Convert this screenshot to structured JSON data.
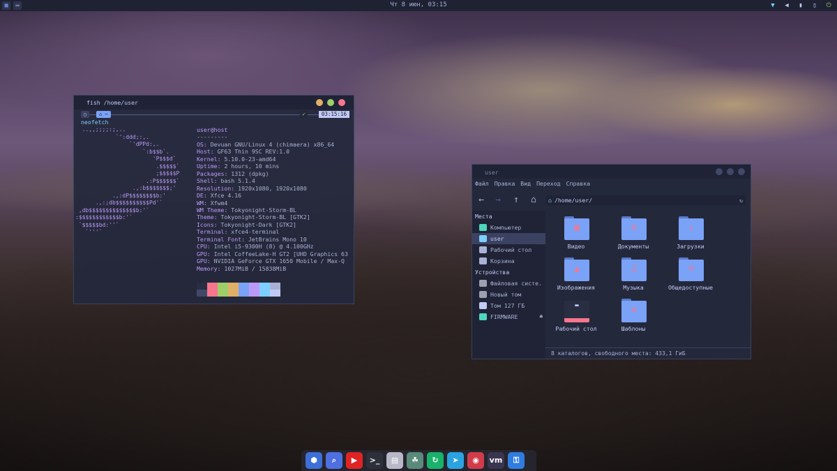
{
  "top_panel": {
    "clock": "Чт   8 июн, 03:15",
    "left_buttons": [
      "menu-icon",
      "terminal-icon"
    ],
    "right_icons": [
      "wifi-icon",
      "volume-icon",
      "battery-icon",
      "clipboard-icon",
      "power-icon"
    ]
  },
  "terminal": {
    "title": "fish /home/user",
    "prompt_time": "03:15:16",
    "prompt_chip_1": "○",
    "prompt_chip_2": "⌂ ~",
    "prompt_ok": "✓",
    "command": "neofetch",
    "ascii_art": "  ..,,;;;;:;,..\n            `':ddd;:,.\n                `'dPPd:,.\n                    `:b$$b`.\n                       'P$$$d`\n                        .$$$$$`\n                        ;$$$$$P\n                     .:P$$$$$$`\n                 .,:b$$$$$$$;'\n           .,:dP$$$$$$$$b:'\n      .,:;db$$$$$$$$$$Pd'`\n ,db$$$$$$$$$$$$$$b:'`\n:$$$$$$$$$$$$b:'`\n `$$$$$bd:''`\n   `'''`",
    "user_host": "user@host",
    "separator": "---------",
    "info": [
      {
        "k": "OS",
        "v": "Devuan GNU/Linux 4 (chimaera) x86_64"
      },
      {
        "k": "Host",
        "v": "GF63 Thin 9SC REV:1.0"
      },
      {
        "k": "Kernel",
        "v": "5.10.0-23-amd64"
      },
      {
        "k": "Uptime",
        "v": "2 hours, 10 mins"
      },
      {
        "k": "Packages",
        "v": "1312 (dpkg)"
      },
      {
        "k": "Shell",
        "v": "bash 5.1.4"
      },
      {
        "k": "Resolution",
        "v": "1920x1080, 1920x1080"
      },
      {
        "k": "DE",
        "v": "Xfce 4.16"
      },
      {
        "k": "WM",
        "v": "Xfwm4"
      },
      {
        "k": "WM Theme",
        "v": "Tokyonight-Storm-BL"
      },
      {
        "k": "Theme",
        "v": "Tokyonight-Storm-BL [GTK2]"
      },
      {
        "k": "Icons",
        "v": "Tokyonight-Dark [GTK2]"
      },
      {
        "k": "Terminal",
        "v": "xfce4-terminal"
      },
      {
        "k": "Terminal Font",
        "v": "JetBrains Mono 10"
      },
      {
        "k": "CPU",
        "v": "Intel i5-9300H (8) @ 4.100GHz"
      },
      {
        "k": "GPU",
        "v": "Intel CoffeeLake-H GT2 [UHD Graphics 63"
      },
      {
        "k": "GPU",
        "v": "NVIDIA GeForce GTX 1650 Mobile / Max-Q"
      },
      {
        "k": "Memory",
        "v": "1027MiB / 15838MiB"
      }
    ],
    "palette_top": [
      "#2a2e42",
      "#f7768e",
      "#9ece6a",
      "#e0af68",
      "#7aa2f7",
      "#bb9af7",
      "#7dcfff",
      "#a9b1d6"
    ],
    "palette_bottom": [
      "#414868",
      "#f7768e",
      "#9ece6a",
      "#e0af68",
      "#7aa2f7",
      "#bb9af7",
      "#7dcfff",
      "#c0caf5"
    ]
  },
  "file_manager": {
    "title": "user",
    "menu": [
      "Файл",
      "Правка",
      "Вид",
      "Переход",
      "Справка"
    ],
    "path": "/home/user/",
    "places_header": "Места",
    "places": [
      {
        "label": "Компьютер",
        "icon": "computer-icon",
        "color": "#4fd6be",
        "selected": false
      },
      {
        "label": "user",
        "icon": "home-icon",
        "color": "#7dcfff",
        "selected": true
      },
      {
        "label": "Рабочий стол",
        "icon": "desktop-icon",
        "color": "#a9b1d6",
        "selected": false
      },
      {
        "label": "Корзина",
        "icon": "trash-icon",
        "color": "#a9b1d6",
        "selected": false
      }
    ],
    "devices_header": "Устройства",
    "devices": [
      {
        "label": "Файловая систе...",
        "icon": "drive-icon",
        "color": "#9aa0b0",
        "eject": ""
      },
      {
        "label": "Новый том",
        "icon": "drive-icon",
        "color": "#9aa0b0",
        "eject": ""
      },
      {
        "label": "Том 127 ГБ",
        "icon": "drive-icon",
        "color": "#c0caf5",
        "eject": ""
      },
      {
        "label": "FIRMWARE",
        "icon": "usb-icon",
        "color": "#4fd6be",
        "eject": "⏏"
      }
    ],
    "items": [
      {
        "label": "Видео",
        "icon": "video-folder-icon",
        "glyph": "▦"
      },
      {
        "label": "Документы",
        "icon": "documents-folder-icon",
        "glyph": "≡"
      },
      {
        "label": "Загрузки",
        "icon": "downloads-folder-icon",
        "glyph": "↓"
      },
      {
        "label": "Изображения",
        "icon": "pictures-folder-icon",
        "glyph": "▲"
      },
      {
        "label": "Музыка",
        "icon": "music-folder-icon",
        "glyph": "♫"
      },
      {
        "label": "Общедоступные",
        "icon": "public-folder-icon",
        "glyph": "☺"
      },
      {
        "label": "Рабочий стол",
        "icon": "desktop-folder-icon",
        "glyph": "▬"
      },
      {
        "label": "Шаблоны",
        "icon": "templates-folder-icon",
        "glyph": "≡"
      }
    ],
    "status": "8 каталогов, свободного места: 433,1 ГиБ"
  },
  "dock": [
    {
      "name": "dock-app-cube-icon",
      "color": "#3d6fd6",
      "glyph": "⬢"
    },
    {
      "name": "dock-app-search-icon",
      "color": "#4e6fe0",
      "glyph": "⌕"
    },
    {
      "name": "dock-app-youtube-icon",
      "color": "#e02424",
      "glyph": "▶"
    },
    {
      "name": "dock-app-terminal-icon",
      "color": "#2d2f3a",
      "glyph": ">_"
    },
    {
      "name": "dock-app-files-icon",
      "color": "#b8b8c8",
      "glyph": "▤"
    },
    {
      "name": "dock-app-tweaks-icon",
      "color": "#5a8a7a",
      "glyph": "☘"
    },
    {
      "name": "dock-app-sync-icon",
      "color": "#19b26b",
      "glyph": "↻"
    },
    {
      "name": "dock-app-telegram-icon",
      "color": "#2aa3e0",
      "glyph": "➤"
    },
    {
      "name": "dock-app-media-icon",
      "color": "#d03c4a",
      "glyph": "◉"
    },
    {
      "name": "dock-app-vm-icon",
      "color": "#3a3550",
      "glyph": "vm"
    },
    {
      "name": "dock-app-keys-icon",
      "color": "#2f7de0",
      "glyph": "⚿"
    }
  ]
}
